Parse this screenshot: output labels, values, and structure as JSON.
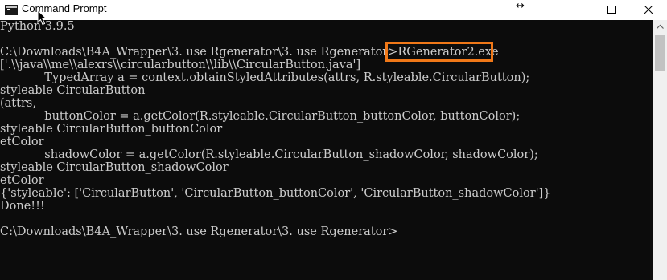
{
  "window": {
    "title": "Command Prompt"
  },
  "titlebar_buttons": {
    "minimize": "minimize",
    "maximize": "maximize",
    "close": "close"
  },
  "console": {
    "lines": [
      "Python 3.9.5",
      "",
      "C:\\Downloads\\B4A_Wrapper\\3. use Rgenerator\\3. use Rgenerator>RGenerator2.exe",
      "['.\\\\java\\\\me\\\\alexrs\\\\circularbutton\\\\lib\\\\CircularButton.java']",
      "            TypedArray a = context.obtainStyledAttributes(attrs, R.styleable.CircularButton);",
      "styleable CircularButton",
      "(attrs,",
      "            buttonColor = a.getColor(R.styleable.CircularButton_buttonColor, buttonColor);",
      "styleable CircularButton_buttonColor",
      "etColor",
      "            shadowColor = a.getColor(R.styleable.CircularButton_shadowColor, shadowColor);",
      "styleable CircularButton_shadowColor",
      "etColor",
      "{'styleable': ['CircularButton', 'CircularButton_buttonColor', 'CircularButton_shadowColor']}",
      "Done!!!",
      "",
      "C:\\Downloads\\B4A_Wrapper\\3. use Rgenerator\\3. use Rgenerator>"
    ]
  },
  "colors": {
    "console_bg": "#0c0c0c",
    "console_text": "#cccccc",
    "highlight": "#f07818",
    "titlebar_bg": "#ffffff"
  }
}
